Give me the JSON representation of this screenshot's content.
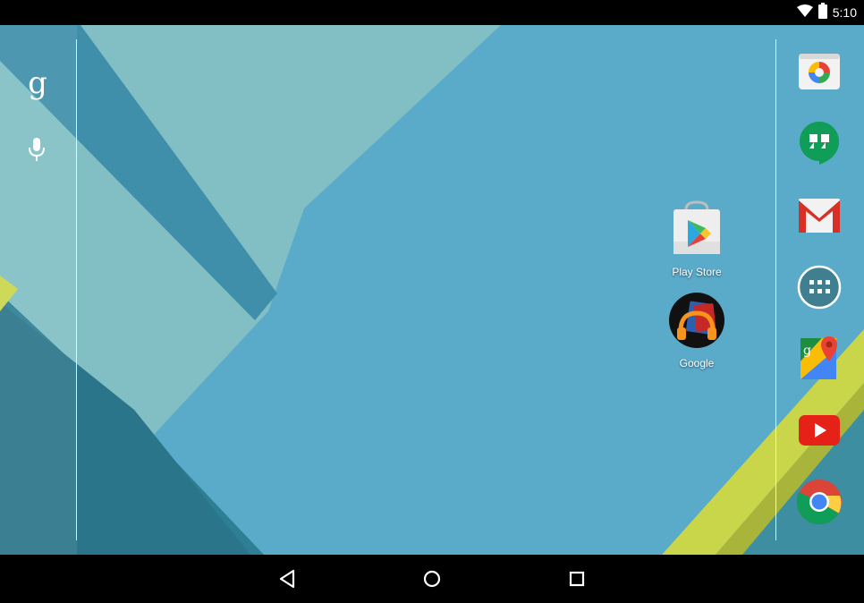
{
  "status_bar": {
    "time": "5:10",
    "icons": [
      "wifi-icon",
      "battery-icon"
    ]
  },
  "search": {
    "logo": "g",
    "icons": [
      "google-search-icon",
      "microphone-icon"
    ]
  },
  "desktop": {
    "apps": [
      {
        "label": "Play Store",
        "icon": "play-store-icon"
      },
      {
        "label": "Google",
        "icon": "google-play-music-icon"
      }
    ]
  },
  "dock": {
    "apps": [
      "photos-camera-icon",
      "hangouts-icon",
      "gmail-icon",
      "all-apps-icon",
      "maps-icon",
      "youtube-icon",
      "chrome-icon"
    ]
  },
  "navigation": {
    "buttons": [
      "back-icon",
      "home-icon",
      "recents-icon"
    ]
  },
  "colors": {
    "wallpaper_main": "#5aaac9",
    "wallpaper_light": "#81bfc5",
    "wallpaper_dark": "#3d8aa6",
    "accent_yellow": "#c9d64a",
    "bars": "#000000"
  }
}
